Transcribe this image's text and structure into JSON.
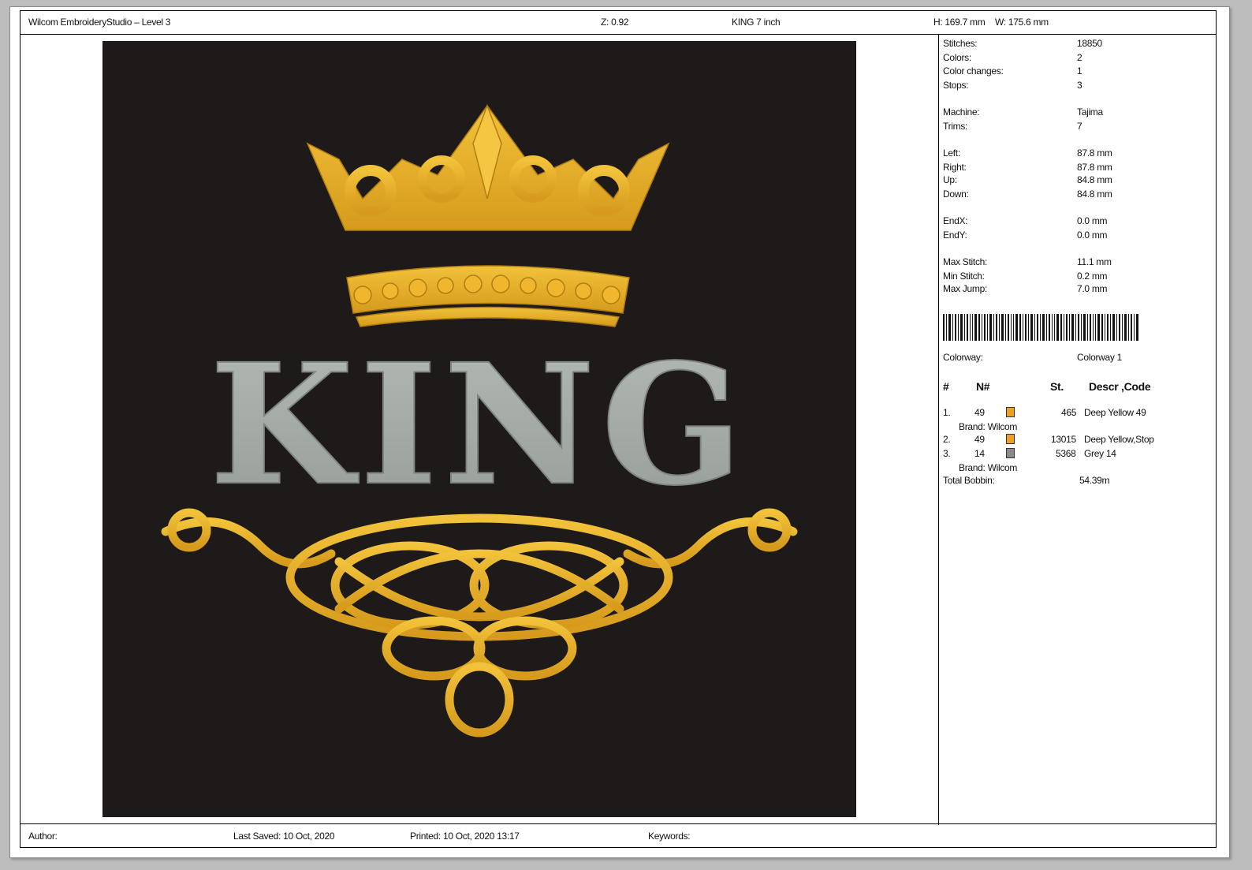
{
  "header": {
    "app_title": "Wilcom EmbroideryStudio – Level 3",
    "zoom": "Z: 0.92",
    "design_name": "KING 7  inch",
    "height": "H: 169.7 mm",
    "width": "W: 175.6 mm"
  },
  "design": {
    "text": "KING",
    "colors": {
      "background": "#1e1a19",
      "gold": "#e3ac2a",
      "grey": "#a4aba6"
    }
  },
  "stats": {
    "stitches": {
      "label": "Stitches:",
      "value": "18850"
    },
    "colors": {
      "label": "Colors:",
      "value": "2"
    },
    "color_changes": {
      "label": "Color changes:",
      "value": "1"
    },
    "stops": {
      "label": "Stops:",
      "value": "3"
    },
    "machine": {
      "label": "Machine:",
      "value": "Tajima"
    },
    "trims": {
      "label": "Trims:",
      "value": "7"
    },
    "left": {
      "label": "Left:",
      "value": "87.8 mm"
    },
    "right": {
      "label": "Right:",
      "value": "87.8 mm"
    },
    "up": {
      "label": "Up:",
      "value": "84.8 mm"
    },
    "down": {
      "label": "Down:",
      "value": "84.8 mm"
    },
    "endx": {
      "label": "EndX:",
      "value": "0.0 mm"
    },
    "endy": {
      "label": "EndY:",
      "value": "0.0 mm"
    },
    "max_stitch": {
      "label": "Max Stitch:",
      "value": "11.1 mm"
    },
    "min_stitch": {
      "label": "Min Stitch:",
      "value": "0.2 mm"
    },
    "max_jump": {
      "label": "Max Jump:",
      "value": "7.0 mm"
    }
  },
  "colorway": {
    "label": "Colorway:",
    "value": "Colorway 1"
  },
  "color_table": {
    "headers": {
      "num": "#",
      "n": "N#",
      "st": "St.",
      "descr": "Descr ,Code"
    },
    "rows": [
      {
        "index": "1.",
        "n": "49",
        "swatch": "#f0a020",
        "st": "465",
        "descr": "Deep Yellow 49",
        "brand": "Brand: Wilcom"
      },
      {
        "index": "2.",
        "n": "49",
        "swatch": "#f0a020",
        "st": "13015",
        "descr": "Deep Yellow,Stop"
      },
      {
        "index": "3.",
        "n": "14",
        "swatch": "#8a8a8a",
        "st": "5368",
        "descr": "Grey 14",
        "brand": "Brand: Wilcom"
      }
    ],
    "total_bobbin": {
      "label": "Total Bobbin:",
      "value": "54.39m"
    }
  },
  "footer": {
    "author": "Author:",
    "last_saved": "Last Saved: 10 Oct, 2020",
    "printed": "Printed: 10 Oct, 2020 13:17",
    "keywords": "Keywords:"
  }
}
